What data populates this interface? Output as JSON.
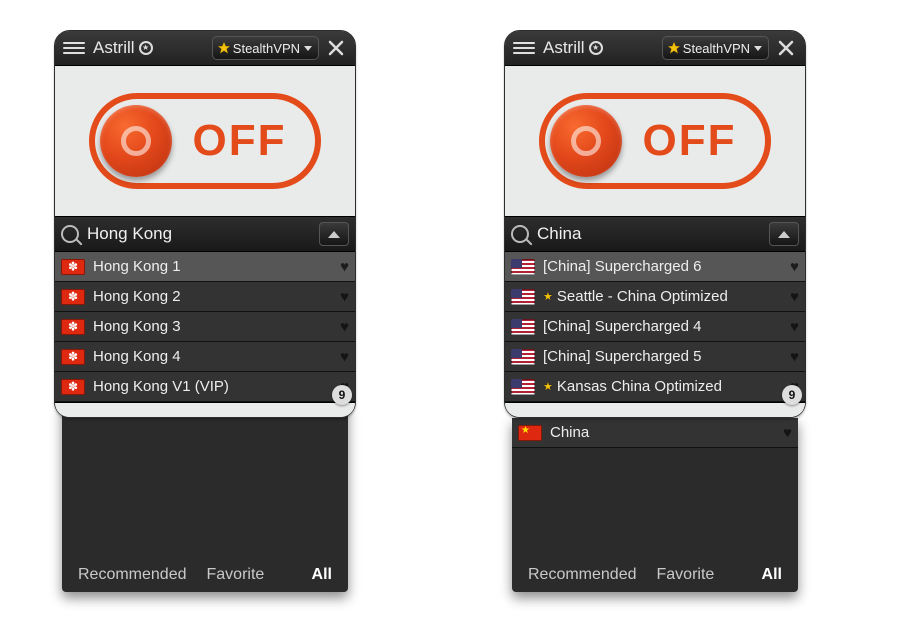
{
  "app": {
    "title": "Astrill",
    "protocol_label": "StealthVPN"
  },
  "toggle": {
    "state_label": "OFF"
  },
  "tabs": {
    "recommended": "Recommended",
    "favorite": "Favorite",
    "all": "All",
    "active": "All"
  },
  "badge": {
    "count": "9"
  },
  "panels": [
    {
      "id": "left",
      "search": "Hong Kong",
      "servers": [
        {
          "flag": "hk",
          "name": "Hong Kong 1",
          "selected": true,
          "star": false
        },
        {
          "flag": "hk",
          "name": "Hong Kong 2",
          "selected": false,
          "star": false
        },
        {
          "flag": "hk",
          "name": "Hong Kong 3",
          "selected": false,
          "star": false
        },
        {
          "flag": "hk",
          "name": "Hong Kong 4",
          "selected": false,
          "star": false
        },
        {
          "flag": "hk",
          "name": "Hong Kong V1 (VIP)",
          "selected": false,
          "star": false
        }
      ],
      "extra_servers": []
    },
    {
      "id": "right",
      "search": "China",
      "servers": [
        {
          "flag": "us",
          "name": "[China] Supercharged 6",
          "selected": true,
          "star": false
        },
        {
          "flag": "us",
          "name": "Seattle - China Optimized",
          "selected": false,
          "star": true
        },
        {
          "flag": "us",
          "name": "[China] Supercharged 4",
          "selected": false,
          "star": false
        },
        {
          "flag": "us",
          "name": "[China] Supercharged 5",
          "selected": false,
          "star": false
        },
        {
          "flag": "us",
          "name": "Kansas China Optimized",
          "selected": false,
          "star": true
        }
      ],
      "extra_servers": [
        {
          "flag": "cn",
          "name": "China",
          "selected": false,
          "star": false
        }
      ]
    }
  ]
}
